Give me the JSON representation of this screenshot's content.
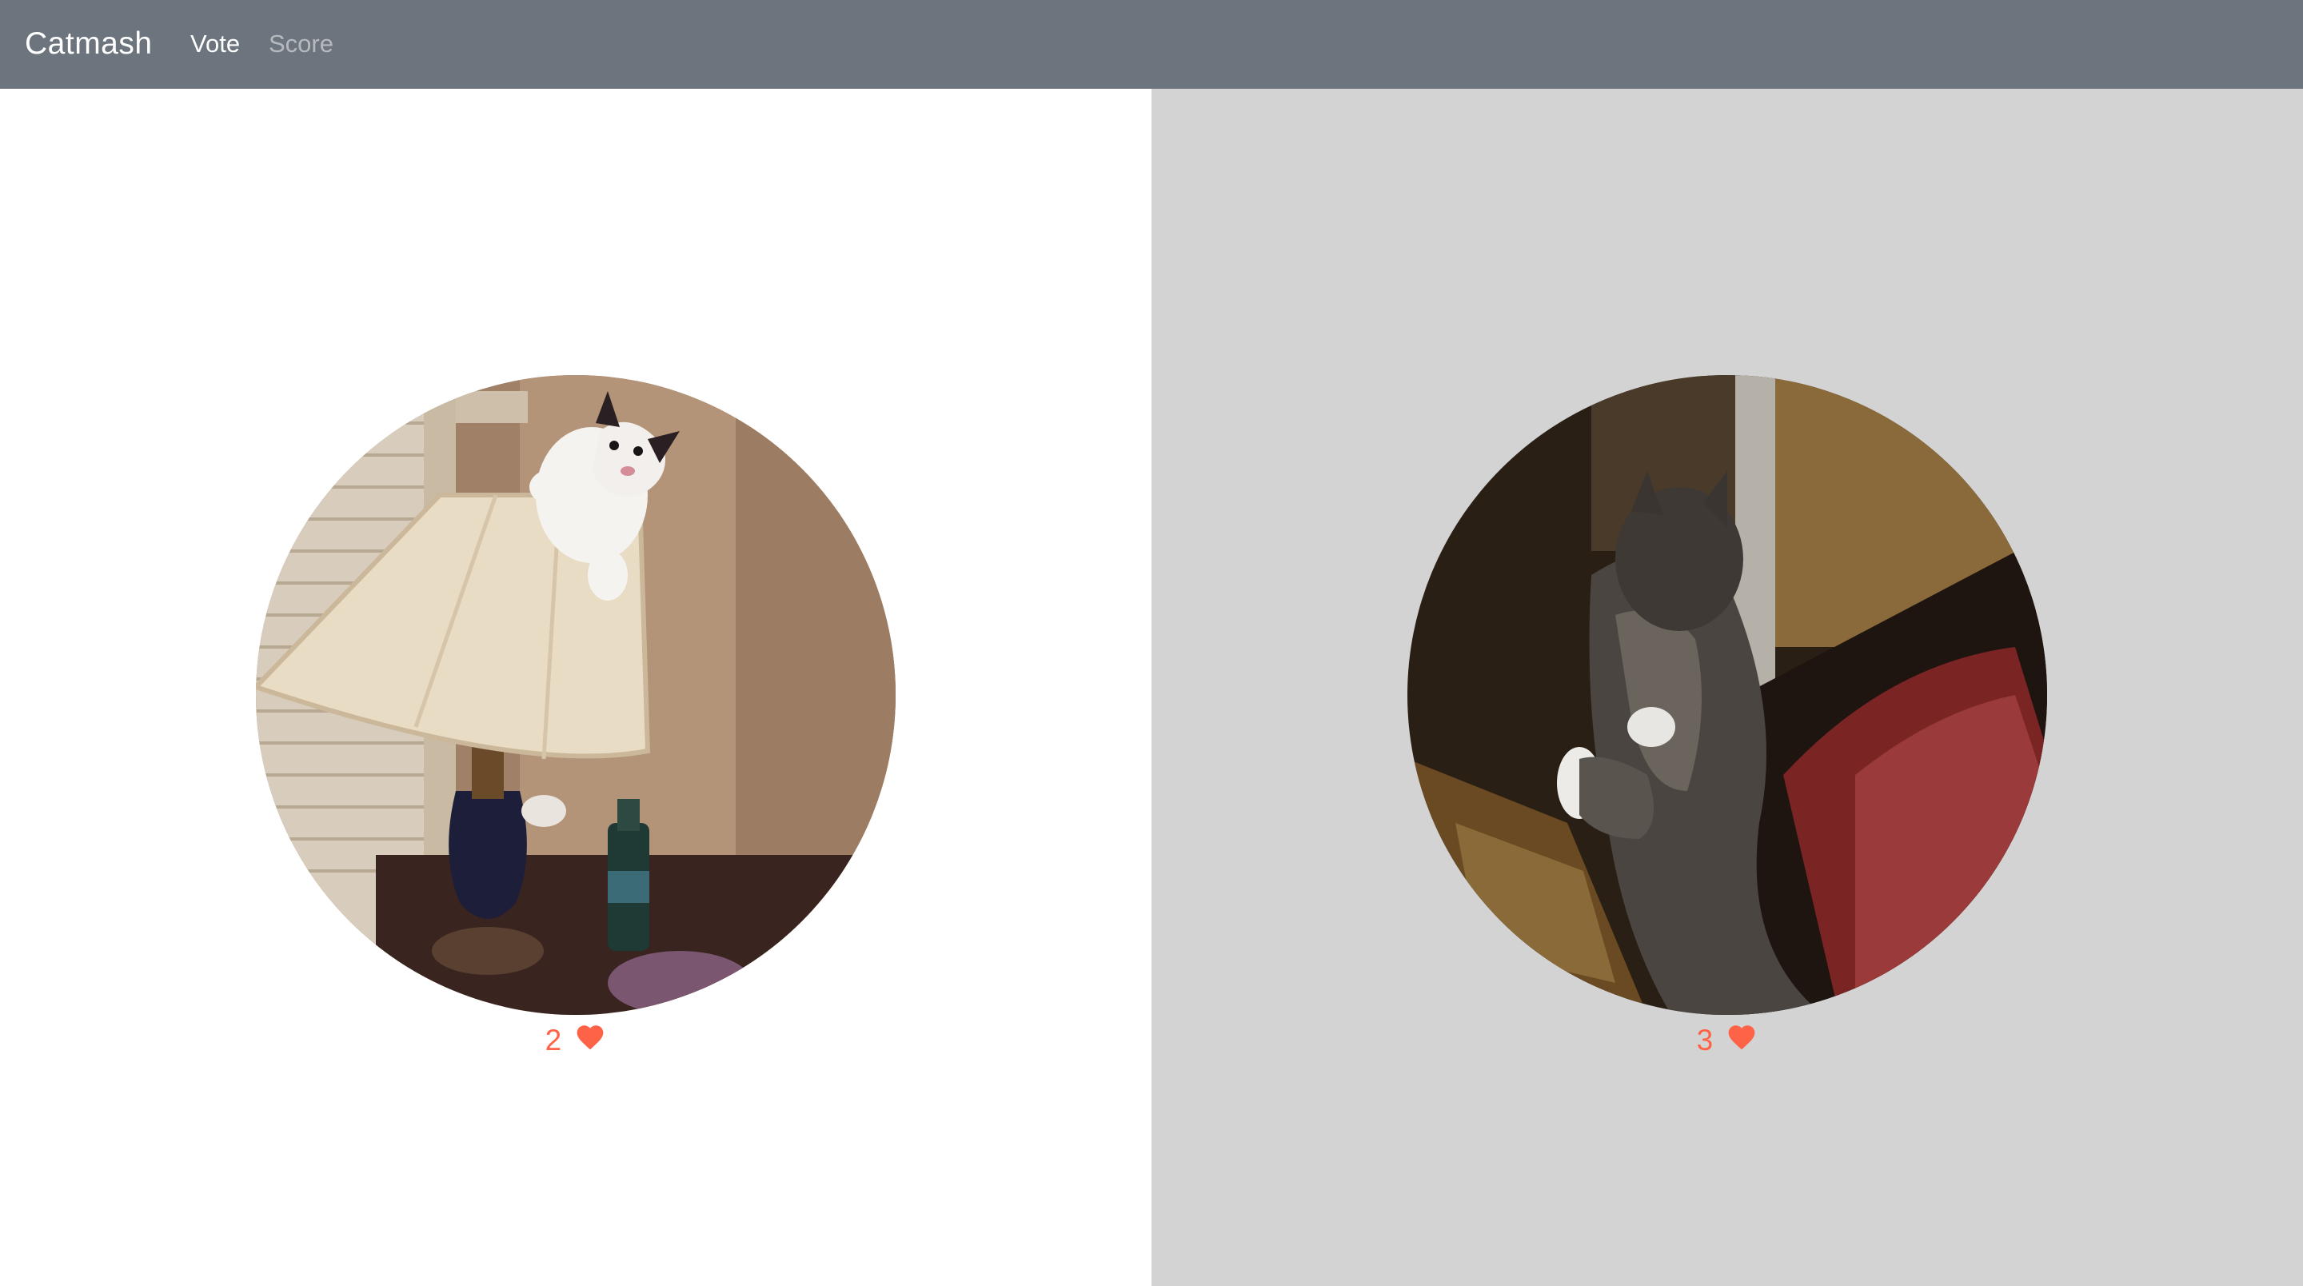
{
  "navbar": {
    "brand": "Catmash",
    "links": [
      {
        "label": "Vote",
        "active": true
      },
      {
        "label": "Score",
        "active": false
      }
    ],
    "background": "#6c757d"
  },
  "cats": [
    {
      "votes": "2",
      "icon": "heart-icon",
      "panel_background": "#ffffff"
    },
    {
      "votes": "3",
      "icon": "heart-icon",
      "panel_background": "#d3d3d3"
    }
  ],
  "accent": "#ff6347"
}
